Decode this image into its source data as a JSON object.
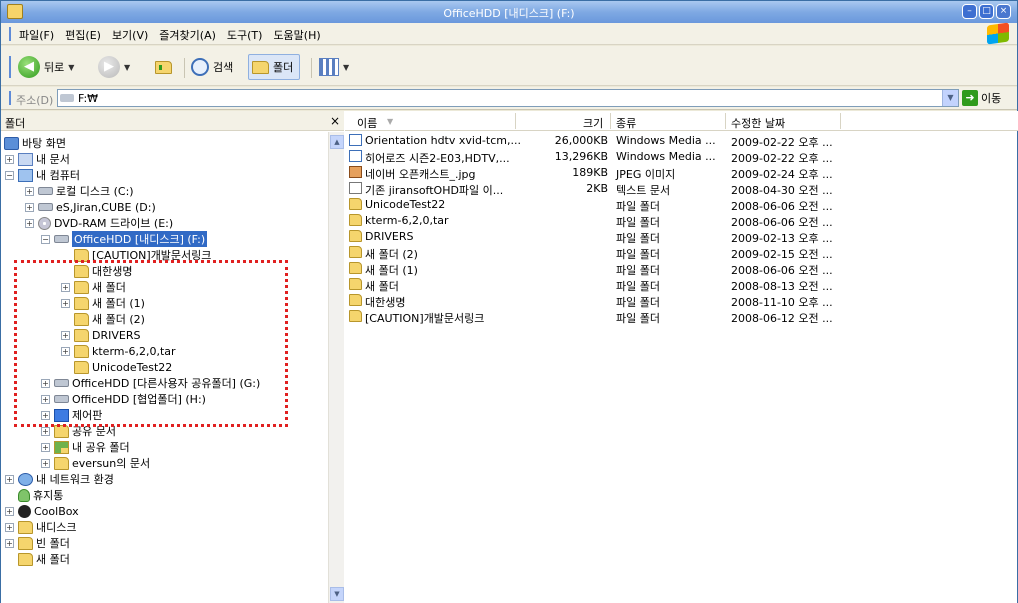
{
  "window": {
    "title": "OfficeHDD [내디스크] (F:)"
  },
  "menu": [
    "파일(F)",
    "편집(E)",
    "보기(V)",
    "즐겨찾기(A)",
    "도구(T)",
    "도움말(H)"
  ],
  "toolbar": {
    "back_label": "뒤로",
    "search_label": "검색",
    "folders_label": "폴더"
  },
  "address": {
    "label": "주소(D)",
    "path": "F:₩",
    "go_label": "이동"
  },
  "tree": {
    "header": "폴더",
    "close": "×",
    "items": [
      {
        "label": "바탕 화면",
        "icon": "desktop-icon"
      },
      {
        "label": "내 문서",
        "icon": "my-documents-icon"
      },
      {
        "label": "내 컴퓨터",
        "icon": "my-computer-icon"
      },
      {
        "label": "로컬 디스크 (C:)",
        "icon": "drive-icon"
      },
      {
        "label": "eS,Jiran,CUBE (D:)",
        "icon": "drive-icon"
      },
      {
        "label": "DVD-RAM 드라이브 (E:)",
        "icon": "cd-drive-icon"
      },
      {
        "label": "OfficeHDD [내디스크] (F:)",
        "icon": "drive-icon"
      },
      {
        "label": "[CAUTION]개발문서링크",
        "icon": "folder-icon"
      },
      {
        "label": "대한생명",
        "icon": "folder-icon"
      },
      {
        "label": "새 폴더",
        "icon": "folder-icon"
      },
      {
        "label": "새 폴더 (1)",
        "icon": "folder-icon"
      },
      {
        "label": "새 폴더 (2)",
        "icon": "folder-icon"
      },
      {
        "label": "DRIVERS",
        "icon": "folder-icon"
      },
      {
        "label": "kterm-6,2,0,tar",
        "icon": "folder-icon"
      },
      {
        "label": "UnicodeTest22",
        "icon": "folder-icon"
      },
      {
        "label": "OfficeHDD [다른사용자 공유폴더] (G:)",
        "icon": "drive-icon"
      },
      {
        "label": "OfficeHDD [협업폴더] (H:)",
        "icon": "drive-icon"
      },
      {
        "label": "제어판",
        "icon": "control-panel-icon"
      },
      {
        "label": "공유 문서",
        "icon": "folder-icon"
      },
      {
        "label": "내 공유 폴더",
        "icon": "shared-folder-icon"
      },
      {
        "label": "eversun의 문서",
        "icon": "folder-icon"
      },
      {
        "label": "내 네트워크 환경",
        "icon": "network-icon"
      },
      {
        "label": "휴지통",
        "icon": "recycle-bin-icon"
      },
      {
        "label": "CoolBox",
        "icon": "coolbox-icon"
      },
      {
        "label": "내디스크",
        "icon": "folder-icon"
      },
      {
        "label": "빈 폴더",
        "icon": "folder-icon"
      },
      {
        "label": "새 폴더",
        "icon": "folder-icon"
      }
    ]
  },
  "list": {
    "columns": [
      "이름",
      "크기",
      "종류",
      "수정한 날짜"
    ],
    "rows": [
      {
        "name": "Orientation hdtv xvid-tcm,...",
        "size": "26,000KB",
        "type": "Windows Media ...",
        "date": "2009-02-22 오후 ...",
        "icon": "media-file-icon"
      },
      {
        "name": "히어로즈 시즌2-E03,HDTV,...",
        "size": "13,296KB",
        "type": "Windows Media ...",
        "date": "2009-02-22 오후 ...",
        "icon": "media-file-icon"
      },
      {
        "name": "네이버 오픈캐스트_.jpg",
        "size": "189KB",
        "type": "JPEG 이미지",
        "date": "2009-02-24 오후 ...",
        "icon": "jpeg-file-icon"
      },
      {
        "name": "기존 jiransoftOHD파일 이...",
        "size": "2KB",
        "type": "텍스트 문서",
        "date": "2008-04-30 오전 ...",
        "icon": "text-file-icon"
      },
      {
        "name": "UnicodeTest22",
        "size": "",
        "type": "파일 폴더",
        "date": "2008-06-06 오전 ...",
        "icon": "folder-icon"
      },
      {
        "name": "kterm-6,2,0,tar",
        "size": "",
        "type": "파일 폴더",
        "date": "2008-06-06 오전 ...",
        "icon": "folder-icon"
      },
      {
        "name": "DRIVERS",
        "size": "",
        "type": "파일 폴더",
        "date": "2009-02-13 오후 ...",
        "icon": "folder-icon"
      },
      {
        "name": "새 폴더 (2)",
        "size": "",
        "type": "파일 폴더",
        "date": "2009-02-15 오전 ...",
        "icon": "folder-icon"
      },
      {
        "name": "새 폴더 (1)",
        "size": "",
        "type": "파일 폴더",
        "date": "2008-06-06 오전 ...",
        "icon": "folder-icon"
      },
      {
        "name": "새 폴더",
        "size": "",
        "type": "파일 폴더",
        "date": "2008-08-13 오전 ...",
        "icon": "folder-icon"
      },
      {
        "name": "대한생명",
        "size": "",
        "type": "파일 폴더",
        "date": "2008-11-10 오후 ...",
        "icon": "folder-icon"
      },
      {
        "name": "[CAUTION]개발문서링크",
        "size": "",
        "type": "파일 폴더",
        "date": "2008-06-12 오전 ...",
        "icon": "folder-icon"
      }
    ]
  }
}
